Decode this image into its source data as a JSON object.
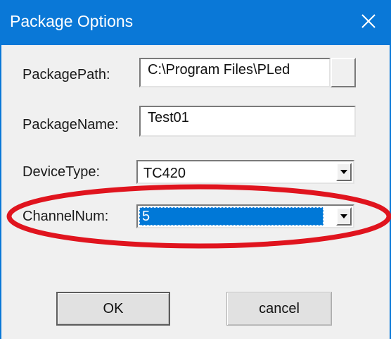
{
  "window": {
    "title": "Package Options"
  },
  "fields": {
    "package_path": {
      "label": "PackagePath:",
      "value": "C:\\Program Files\\PLed"
    },
    "package_name": {
      "label": "PackageName:",
      "value": "Test01"
    },
    "device_type": {
      "label": "DeviceType:",
      "selected": "TC420"
    },
    "channel_num": {
      "label": "ChannelNum:",
      "selected": "5"
    }
  },
  "buttons": {
    "ok_label": "OK",
    "cancel_label": "cancel"
  },
  "icons": {
    "close": "close-icon",
    "dropdown": "chevron-down-icon"
  },
  "colors": {
    "titlebar": "#0a78d7",
    "selection": "#0078d7",
    "annotation": "#e0141e"
  }
}
